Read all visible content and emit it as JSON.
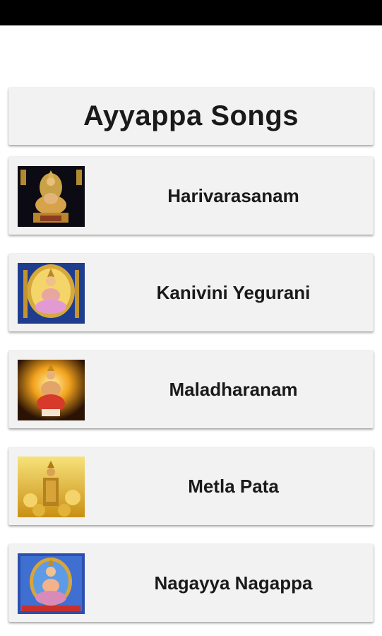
{
  "app": {
    "title": "Ayyappa Songs"
  },
  "songs": [
    {
      "label": "Harivarasanam",
      "icon": "ayyappa-deity-image-dark"
    },
    {
      "label": "Kanivini Yegurani",
      "icon": "ayyappa-deity-image-blue-arch"
    },
    {
      "label": "Maladharanam",
      "icon": "ayyappa-deity-image-orange-glow"
    },
    {
      "label": "Metla Pata",
      "icon": "ayyappa-deity-image-golden"
    },
    {
      "label": "Nagayya Nagappa",
      "icon": "ayyappa-deity-image-blue-frame"
    }
  ]
}
